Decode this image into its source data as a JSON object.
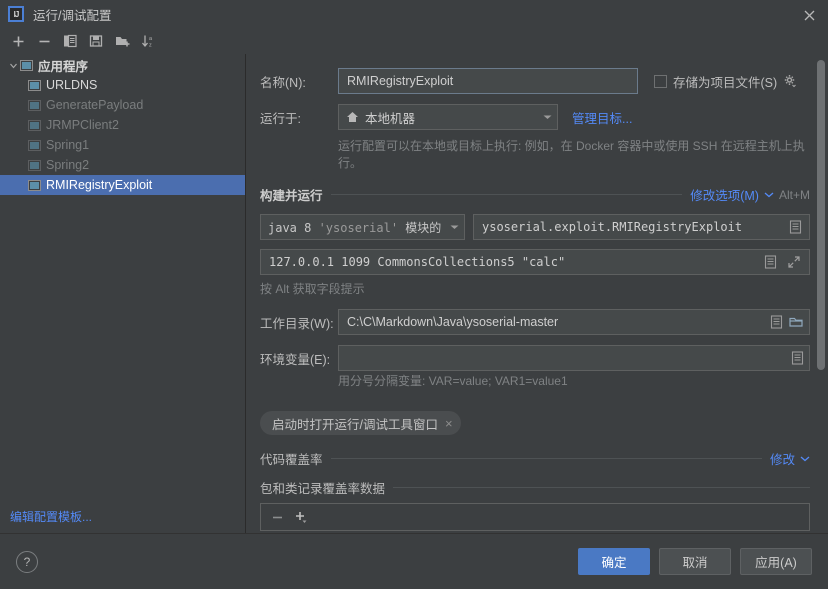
{
  "window": {
    "title": "运行/调试配置",
    "logo_text": "IJ",
    "close_icon": "close-icon"
  },
  "toolbar": {
    "items": [
      {
        "name": "add-configuration-button",
        "icon": "plus-icon"
      },
      {
        "name": "remove-configuration-button",
        "icon": "minus-icon"
      },
      {
        "name": "copy-configuration-button",
        "icon": "copy-icon"
      },
      {
        "name": "save-configuration-button",
        "icon": "save-icon"
      },
      {
        "name": "new-folder-button",
        "icon": "new-folder-icon"
      },
      {
        "name": "sort-configurations-button",
        "icon": "sort-alpha-icon"
      }
    ]
  },
  "sidebar": {
    "root": {
      "label": "应用程序",
      "expanded": true
    },
    "items": [
      {
        "label": "URLDNS",
        "state": "bright"
      },
      {
        "label": "GeneratePayload",
        "state": "dim"
      },
      {
        "label": "JRMPClient2",
        "state": "dim"
      },
      {
        "label": "Spring1",
        "state": "dim"
      },
      {
        "label": "Spring2",
        "state": "dim"
      },
      {
        "label": "RMIRegistryExploit",
        "state": "selected"
      }
    ],
    "edit_templates_link": "编辑配置模板..."
  },
  "form": {
    "name_label": "名称(N):",
    "name_value": "RMIRegistryExploit",
    "store_as_project_file_label": "存储为项目文件(S)",
    "store_as_project_file_checked": false,
    "run_on_label": "运行于:",
    "run_on_value": "本地机器",
    "manage_targets_link": "管理目标...",
    "run_on_hint": "运行配置可以在本地或目标上执行: 例如，在 Docker 容器中或使用 SSH 在远程主机上执行。"
  },
  "build_and_run": {
    "section_title": "构建并运行",
    "modify_options_link": "修改选项(M)",
    "modify_options_shortcut": "Alt+M",
    "jdk_value_prefix": "java 8 ",
    "jdk_value_quoted": "'ysoserial'",
    "jdk_value_suffix": " 模块的 S",
    "main_class_value": "ysoserial.exploit.RMIRegistryExploit",
    "program_args_value": "127.0.0.1 1099 CommonsCollections5 \"calc\"",
    "args_hint": "按 Alt 获取字段提示",
    "working_dir_label": "工作目录(W):",
    "working_dir_value": "C:\\C\\Markdown\\Java\\ysoserial-master",
    "env_vars_label": "环境变量(E):",
    "env_vars_value": "",
    "env_vars_hint": "用分号分隔变量: VAR=value; VAR1=value1",
    "chip_label": "启动时打开运行/调试工具窗口"
  },
  "coverage": {
    "section_title": "代码覆盖率",
    "modify_link": "修改",
    "subsection_title": "包和类记录覆盖率数据",
    "toolbar": [
      {
        "name": "coverage-remove-button",
        "icon": "minus-icon"
      },
      {
        "name": "coverage-add-button",
        "icon": "plus-dropdown-icon"
      }
    ]
  },
  "footer": {
    "help_label": "?",
    "ok_label": "确定",
    "cancel_label": "取消",
    "apply_label": "应用(A)"
  },
  "colors": {
    "background": "#3c3f41",
    "field_background": "#45494a",
    "selection": "#4b6eaf",
    "link": "#548af7",
    "primary_button": "#4a79c4",
    "text": "#bbbbbb",
    "muted_text": "#7f8284"
  }
}
